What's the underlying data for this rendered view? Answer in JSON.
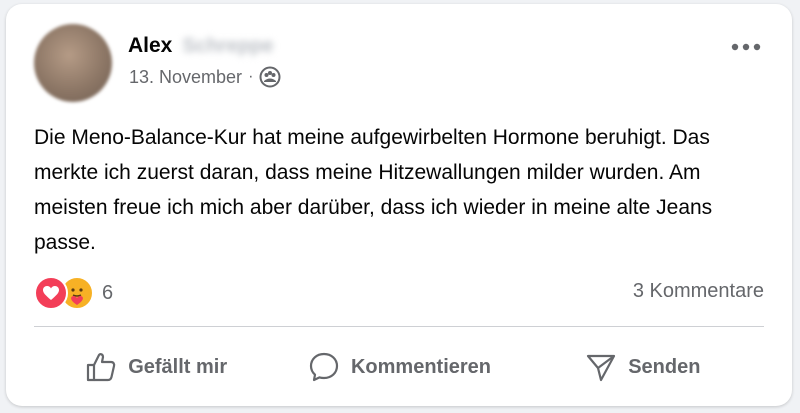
{
  "post": {
    "author_first_name": "Alex",
    "author_last_name_obscured": "Schreppe",
    "date": "13. November",
    "separator": "·",
    "audience_icon": "friends-icon",
    "more_icon": "more-dots-icon",
    "text": "Die Meno-Balance-Kur hat meine aufgewirbelten Hormone beruhigt. Das merkte ich zuerst daran, dass meine Hitzewallungen milder wurden. Am meisten freue ich mich aber darüber, dass ich wieder in meine alte Jeans passe.",
    "reactions": {
      "icons": [
        "love-reaction-icon",
        "care-reaction-icon"
      ],
      "count": "6"
    },
    "comments_count": "3 Kommentare"
  },
  "actions": {
    "like_label": "Gefällt mir",
    "comment_label": "Kommentieren",
    "send_label": "Senden"
  },
  "colors": {
    "love": "#f33e58",
    "care": "#f7b125",
    "secondary_text": "#65676b",
    "divider": "#ced0d4"
  }
}
